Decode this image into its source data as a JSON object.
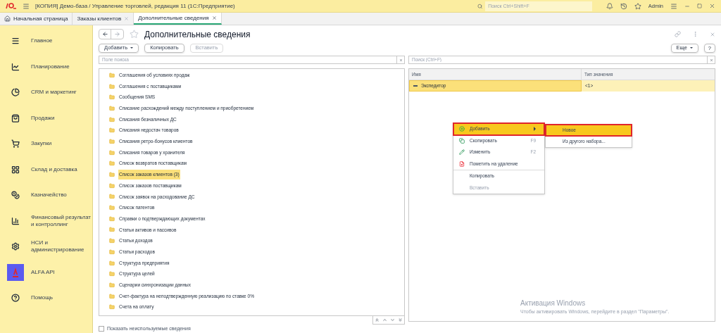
{
  "window": {
    "title": "[КОПИЯ] Демо-база / Управление торговлей, редакция 11  (1С:Предприятие)",
    "search_placeholder": "Поиск Ctrl+Shift+F",
    "user": "Admin"
  },
  "tabs": [
    {
      "label": "Начальная страница",
      "kind": "home",
      "selected": false
    },
    {
      "label": "Заказы клиентов",
      "kind": "doc",
      "selected": false
    },
    {
      "label": "Дополнительные сведения",
      "kind": "doc",
      "selected": true
    }
  ],
  "sidebar": {
    "items": [
      {
        "label": "Главное",
        "kind": "list"
      },
      {
        "label": "Планирование",
        "kind": "plan"
      },
      {
        "label": "CRM и маркетинг",
        "kind": "crm"
      },
      {
        "label": "Продажи",
        "kind": "sales"
      },
      {
        "label": "Закупки",
        "kind": "cart"
      },
      {
        "label": "Склад и доставка",
        "kind": "grid"
      },
      {
        "label": "Казначейство",
        "kind": "coins"
      },
      {
        "label": "Финансовый результат и контроллинг",
        "kind": "chart"
      },
      {
        "label": "НСИ и администрирование",
        "kind": "gear"
      },
      {
        "label": "ALFA API",
        "kind": "logo"
      },
      {
        "label": "Помощь",
        "kind": "help"
      }
    ]
  },
  "form": {
    "title": "Дополнительные сведения",
    "buttons": [
      {
        "label": "Добавить",
        "dropdown": true,
        "disabled": false
      },
      {
        "label": "Копировать",
        "dropdown": false,
        "disabled": false
      },
      {
        "label": "Вставить",
        "dropdown": false,
        "disabled": true
      }
    ],
    "more_button": "Еще",
    "help_button": "?",
    "left_search_placeholder": "Поле поиска",
    "right_search_placeholder": "Поиск (Ctrl+F)",
    "sets": [
      {
        "label": "Соглашения об условиях продаж",
        "selected": false
      },
      {
        "label": "Соглашения с поставщиками",
        "selected": false
      },
      {
        "label": "Сообщения SMS",
        "selected": false
      },
      {
        "label": "Списание расхождений между поступлением и приобретением",
        "selected": false
      },
      {
        "label": "Списания безналичных ДС",
        "selected": false
      },
      {
        "label": "Списания недостач товаров",
        "selected": false
      },
      {
        "label": "Списания ретро-бонусов клиентов",
        "selected": false
      },
      {
        "label": "Списания товаров у хранителя",
        "selected": false
      },
      {
        "label": "Список возвратов поставщикам",
        "selected": false
      },
      {
        "label": "Список заказов клиентов (3)",
        "selected": true
      },
      {
        "label": "Список заказов поставщикам",
        "selected": false
      },
      {
        "label": "Список заявок на расходование ДС",
        "selected": false
      },
      {
        "label": "Список патентов",
        "selected": false
      },
      {
        "label": "Справки о подтверждающих документах",
        "selected": false
      },
      {
        "label": "Статьи активов и пассивов",
        "selected": false
      },
      {
        "label": "Статьи доходов",
        "selected": false
      },
      {
        "label": "Статьи расходов",
        "selected": false
      },
      {
        "label": "Структура предприятия",
        "selected": false
      },
      {
        "label": "Структура целей",
        "selected": false
      },
      {
        "label": "Сценарии синхронизации данных",
        "selected": false
      },
      {
        "label": "Счет-фактура на неподтвержденную реализацию по ставке 0%",
        "selected": false
      },
      {
        "label": "Счета на оплату",
        "selected": false
      }
    ],
    "show_unused": {
      "label": "Показать неиспользуемые сведения",
      "checked": false
    },
    "table": {
      "columns": [
        "Имя",
        "Тип значения"
      ],
      "rows": [
        {
          "name": "Экспедитор",
          "type": "<1>",
          "selected": true
        }
      ]
    }
  },
  "context_menu": {
    "items": [
      {
        "label": "Добавить",
        "kind": "add",
        "selected": true,
        "disabled": false,
        "submenu": true
      },
      {
        "label": "Скопировать",
        "kind": "copy",
        "shortcut": "F9",
        "selected": false,
        "disabled": false,
        "submenu": false
      },
      {
        "label": "Изменить",
        "kind": "edit",
        "shortcut": "F2",
        "selected": false,
        "disabled": false,
        "submenu": false
      },
      {
        "label": "Пометить на удаление",
        "kind": "delete",
        "selected": false,
        "disabled": false,
        "submenu": false
      },
      {
        "label": "Копировать",
        "kind": "plain",
        "selected": false,
        "disabled": false,
        "submenu": false
      },
      {
        "label": "Вставить",
        "kind": "plain",
        "selected": false,
        "disabled": true,
        "submenu": false
      }
    ],
    "submenu": [
      {
        "label": "Новое",
        "selected": true
      },
      {
        "label": "Из другого набора...",
        "selected": false
      }
    ]
  },
  "os_notice": {
    "title": "Активация Windows",
    "text": "Чтобы активировать Windows, перейдите в раздел \"Параметры\"."
  }
}
